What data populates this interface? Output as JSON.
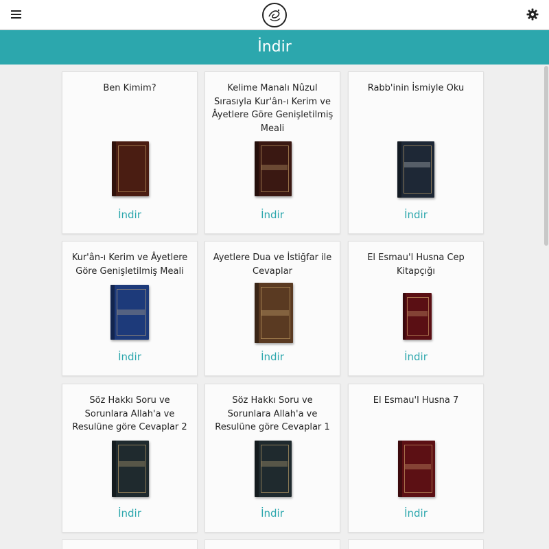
{
  "header": {
    "menu_icon": "hamburger-icon",
    "logo_icon": "calligraphy-logo-icon",
    "settings_icon": "gear-icon",
    "page_title": "İndir"
  },
  "books": [
    {
      "title": "Ben Kimim?",
      "cover_color": "#4a1d12",
      "download_label": "İndir"
    },
    {
      "title": "Kelime Manalı Nûzul Sırasıyla Kur'ân-ı Kerim ve Âyetlere Göre Genişletilmiş Meali",
      "cover_color": "#3a1812",
      "download_label": "İndir"
    },
    {
      "title": "Rabb'inin İsmiyle Oku",
      "cover_color": "#1e2836",
      "download_label": "İndir"
    },
    {
      "title": "Kur'ân-ı Kerim ve Âyetlere Göre Genişletilmiş Meali",
      "cover_color": "#1d3a7a",
      "download_label": "İndir"
    },
    {
      "title": "Ayetlere Dua ve İstiğfar ile Cevaplar",
      "cover_color": "#5a3a22",
      "download_label": "İndir"
    },
    {
      "title": "El Esmau'l Husna Cep Kitapçığı",
      "cover_color": "#5a0f14",
      "download_label": "İndir"
    },
    {
      "title": "Söz Hakkı Soru ve Sorunlara Allah'a ve Resulüne göre Cevaplar 2",
      "cover_color": "#1f2a2e",
      "download_label": "İndir"
    },
    {
      "title": "Söz Hakkı Soru ve Sorunlara Allah'a ve Resulüne göre Cevaplar 1",
      "cover_color": "#1f2a2e",
      "download_label": "İndir"
    },
    {
      "title": "El Esmau'l Husna 7",
      "cover_color": "#5c1014",
      "download_label": "İndir"
    }
  ]
}
